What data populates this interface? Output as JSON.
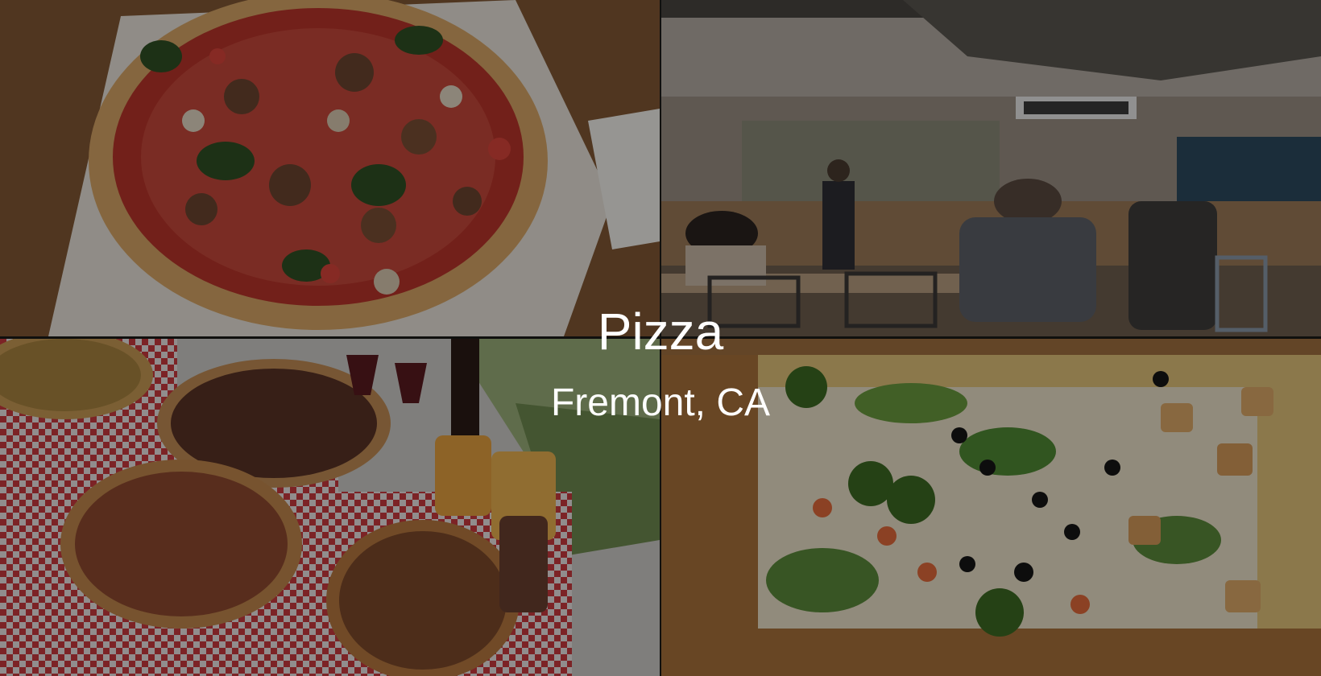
{
  "header": {
    "title": "Pizza",
    "subtitle": "Fremont, CA"
  },
  "photos": [
    {
      "subject": "pizza-on-paper-top-left"
    },
    {
      "subject": "restaurant-interior-top-right"
    },
    {
      "subject": "pizzas-on-checkered-paper-bottom-left"
    },
    {
      "subject": "pizza-closeup-bottom-right"
    }
  ],
  "colors": {
    "text": "#ffffff",
    "overlay": "rgba(0,0,0,0.38)"
  }
}
